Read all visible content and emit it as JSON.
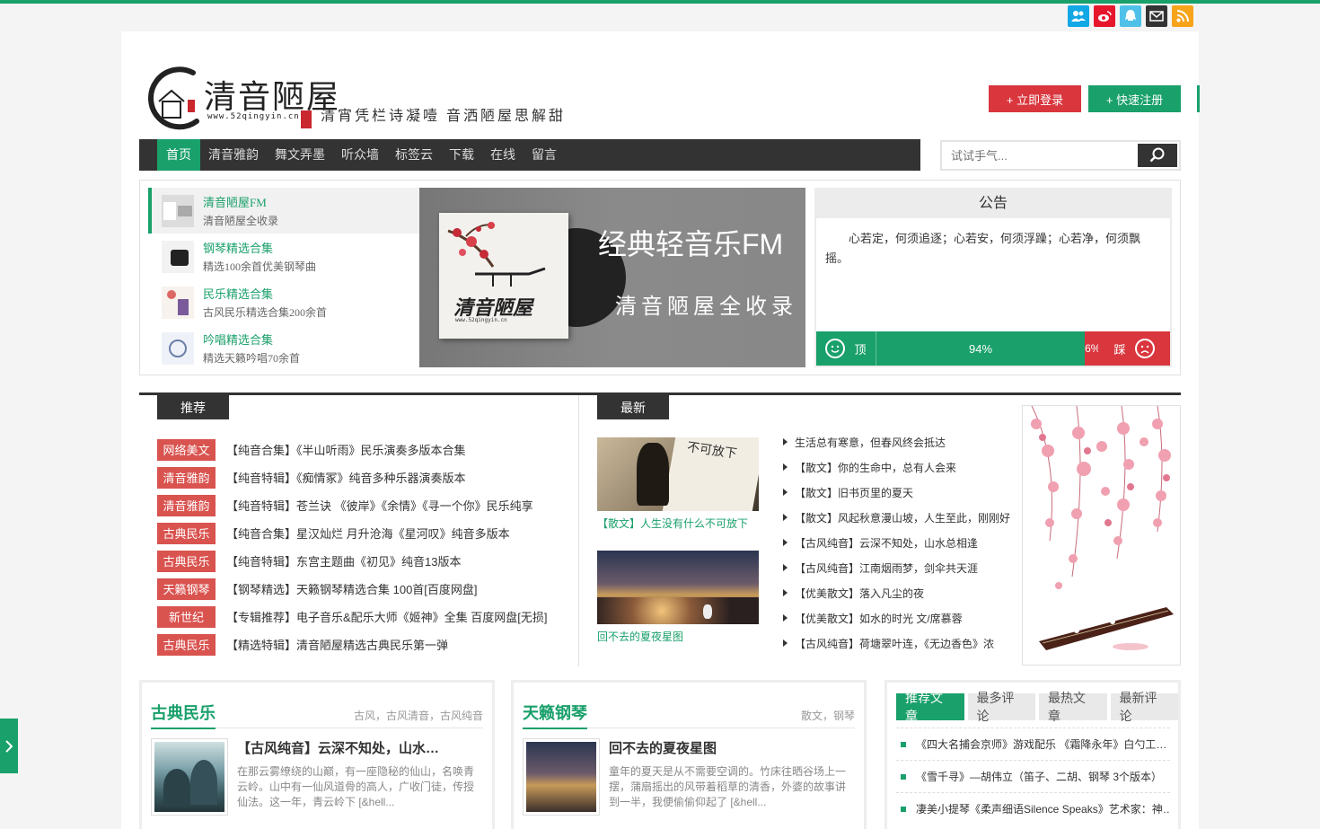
{
  "colors": {
    "brand_green": "#1aa06b",
    "red": "#d9363e",
    "nav_dark": "#333333"
  },
  "social": [
    {
      "icon": "people-icon",
      "color": "#12a7e5"
    },
    {
      "icon": "weibo-icon",
      "color": "#e6162d"
    },
    {
      "icon": "qq-icon",
      "color": "#4fc1e9"
    },
    {
      "icon": "mail-icon",
      "color": "#333333"
    },
    {
      "icon": "rss-icon",
      "color": "#f7a41b"
    }
  ],
  "header": {
    "logo_text": "清音陋屋",
    "logo_url": "www.52qingyin.cn",
    "slogan": "清宵凭栏诗凝噎  音洒陋屋思解甜",
    "login": "+ 立即登录",
    "register": "+ 快速注册"
  },
  "nav": [
    "首页",
    "清音雅韵",
    "舞文弄墨",
    "听众墙",
    "标签云",
    "下载",
    "在线",
    "留言"
  ],
  "search": {
    "placeholder": "试试手气..."
  },
  "featured": [
    {
      "title": "清音陋屋FM",
      "sub": "清音陋屋全收录"
    },
    {
      "title": "钢琴精选合集",
      "sub": "精选100余首优美钢琴曲"
    },
    {
      "title": "民乐精选合集",
      "sub": "古风民乐精选合集200余首"
    },
    {
      "title": "吟唱精选合集",
      "sub": "精选天籁吟唱70余首"
    }
  ],
  "banner": {
    "title": "经典轻音乐FM",
    "sub": "清音陋屋全收录",
    "cover_text": "清音陋屋",
    "cover_url": "www.52qingyin.cn"
  },
  "notice": {
    "head": "公告",
    "body": "心若定，何须追逐；心若安，何须浮躁；心若净，何须飘摇。",
    "up_label": "顶",
    "down_label": "踩",
    "up_pct": "94%",
    "down_pct": "6%"
  },
  "recommend": {
    "tab": "推荐",
    "items": [
      {
        "tag": "网络美文",
        "text": "【纯音合集】《半山听雨》民乐演奏多版本合集"
      },
      {
        "tag": "清音雅韵",
        "text": "【纯音特辑】《痴情冢》纯音多种乐器演奏版本"
      },
      {
        "tag": "清音雅韵",
        "text": "【纯音特辑】苍兰诀 《彼岸》《余情》《寻一个你》民乐纯享"
      },
      {
        "tag": "古典民乐",
        "text": "【纯音合集】星汉灿烂 月升沧海《星河叹》纯音多版本"
      },
      {
        "tag": "古典民乐",
        "text": "【纯音特辑】东宫主题曲《初见》纯音13版本"
      },
      {
        "tag": "天籁钢琴",
        "text": "【钢琴精选】天籁钢琴精选合集 100首[百度网盘]"
      },
      {
        "tag": "新世纪",
        "text": "【专辑推荐】电子音乐&配乐大师《姬神》全集 百度网盘[无损]"
      },
      {
        "tag": "古典民乐",
        "text": "【精选特辑】清音陋屋精选古典民乐第一弹"
      }
    ]
  },
  "latest": {
    "tab": "最新",
    "pics": [
      {
        "caption": "【散文】人生没有什么不可放下",
        "book_text": "不可放下"
      },
      {
        "caption": "回不去的夏夜星图"
      }
    ],
    "items": [
      "生活总有寒意，但春风终会抵达",
      "【散文】你的生命中，总有人会来",
      "【散文】旧书页里的夏天",
      "【散文】风起秋意漫山坡，人生至此，刚刚好",
      "【古风纯音】云深不知处，山水总相逢",
      "【古风纯音】江南烟雨梦，剑伞共天涯",
      "【优美散文】落入凡尘的夜",
      "【优美散文】如水的时光 文/席慕蓉",
      "【古风纯音】荷塘翠叶连，《无边香色》浓"
    ]
  },
  "card1": {
    "heading": "古典民乐",
    "tags": "古风，古风清音，古风纯音",
    "title": "【古风纯音】云深不知处，山水…",
    "desc": "在那云雾缭绕的山巅，有一座隐秘的仙山，名唤青云岭。山中有一仙风道骨的高人，广收门徒，传授仙法。这一年，青云岭下 [&hell..."
  },
  "card2": {
    "heading": "天籁钢琴",
    "tags": "散文，钢琴",
    "title": "回不去的夏夜星图",
    "desc": "童年的夏天是从不需要空调的。竹床往晒谷场上一摆，蒲扇摇出的风带着稻草的清香，外婆的故事讲到一半，我便偷偷仰起了 [&hell..."
  },
  "sidebox": {
    "tabs": [
      "推荐文章",
      "最多评论",
      "最热文章",
      "最新评论"
    ],
    "items": [
      "《四大名捕会京师》游戏配乐 《霜降永年》白勺工…",
      "《雪千寻》—胡伟立（笛子、二胡、钢琴 3个版本）",
      "凄美小提琴《柔声细语Silence Speaks》艺术家：神…"
    ]
  }
}
